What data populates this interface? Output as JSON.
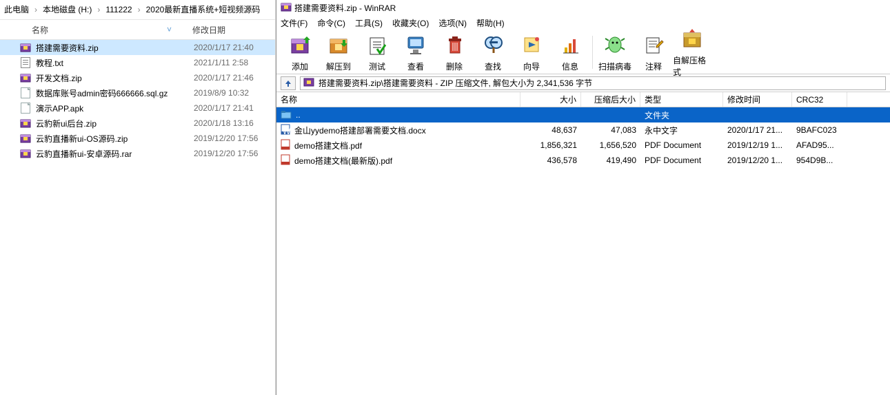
{
  "explorer": {
    "breadcrumb": [
      "此电脑",
      "本地磁盘 (H:)",
      "111222",
      "2020最新直播系统+短视频源码"
    ],
    "columns": {
      "name": "名称",
      "date": "修改日期"
    },
    "rows": [
      {
        "icon": "archive",
        "name": "搭建需要资料.zip",
        "date": "2020/1/17 21:40",
        "selected": true
      },
      {
        "icon": "txt",
        "name": "教程.txt",
        "date": "2021/1/11 2:58"
      },
      {
        "icon": "archive",
        "name": "开发文档.zip",
        "date": "2020/1/17 21:46"
      },
      {
        "icon": "file",
        "name": "数据库账号admin密码666666.sql.gz",
        "date": "2019/8/9 10:32"
      },
      {
        "icon": "file",
        "name": "演示APP.apk",
        "date": "2020/1/17 21:41"
      },
      {
        "icon": "archive",
        "name": "云豹新ui后台.zip",
        "date": "2020/1/18 13:16"
      },
      {
        "icon": "archive",
        "name": "云豹直播新ui-OS源码.zip",
        "date": "2019/12/20 17:56"
      },
      {
        "icon": "archive",
        "name": "云豹直播新ui-安卓源码.rar",
        "date": "2019/12/20 17:56"
      }
    ]
  },
  "winrar": {
    "title": "搭建需要资料.zip - WinRAR",
    "menu": [
      "文件(F)",
      "命令(C)",
      "工具(S)",
      "收藏夹(O)",
      "选项(N)",
      "帮助(H)"
    ],
    "toolbar": [
      "添加",
      "解压到",
      "测试",
      "查看",
      "删除",
      "查找",
      "向导",
      "信息",
      "扫描病毒",
      "注释",
      "自解压格式"
    ],
    "path_text": "搭建需要资料.zip\\搭建需要资料 - ZIP 压缩文件, 解包大小为 2,341,536 字节",
    "columns": {
      "name": "名称",
      "size": "大小",
      "packed": "压缩后大小",
      "type": "类型",
      "date": "修改时间",
      "crc": "CRC32"
    },
    "rows": [
      {
        "icon": "folder",
        "name": "..",
        "size": "",
        "packed": "",
        "type": "文件夹",
        "date": "",
        "crc": "",
        "selected": true
      },
      {
        "icon": "docx",
        "name": "金山yydemo搭建部署需要文档.docx",
        "size": "48,637",
        "packed": "47,083",
        "type": "永中文字",
        "date": "2020/1/17 21...",
        "crc": "9BAFC023"
      },
      {
        "icon": "pdf",
        "name": "demo搭建文档.pdf",
        "size": "1,856,321",
        "packed": "1,656,520",
        "type": "PDF Document",
        "date": "2019/12/19 1...",
        "crc": "AFAD95..."
      },
      {
        "icon": "pdf",
        "name": "demo搭建文档(最新版).pdf",
        "size": "436,578",
        "packed": "419,490",
        "type": "PDF Document",
        "date": "2019/12/20 1...",
        "crc": "954D9B..."
      }
    ]
  }
}
